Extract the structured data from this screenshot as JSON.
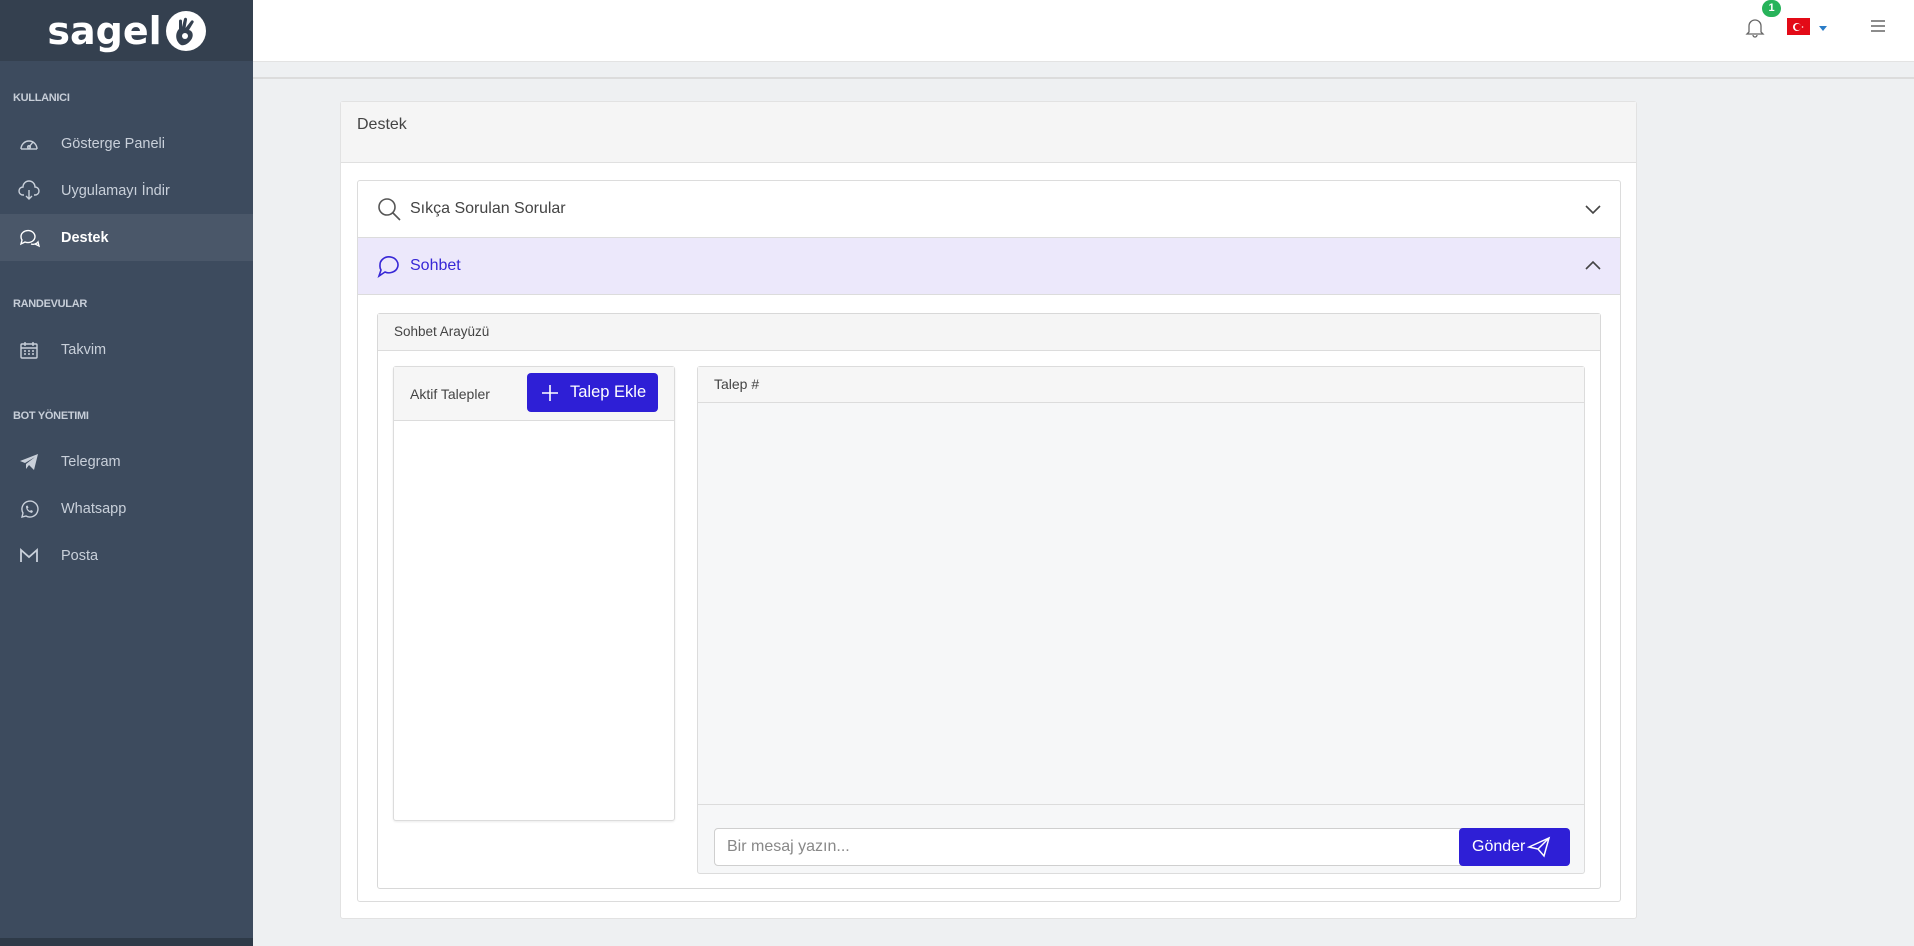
{
  "brand": {
    "name": "sagel"
  },
  "sidebar": {
    "sections": [
      {
        "title": "KULLANICI",
        "items": [
          {
            "label": "Gösterge Paneli",
            "icon": "dashboard-icon"
          },
          {
            "label": "Uygulamayı İndir",
            "icon": "cloud-download-icon"
          },
          {
            "label": "Destek",
            "icon": "chat-icon",
            "active": true
          }
        ]
      },
      {
        "title": "RANDEVULAR",
        "items": [
          {
            "label": "Takvim",
            "icon": "calendar-icon"
          }
        ]
      },
      {
        "title": "BOT YÖNETIMI",
        "items": [
          {
            "label": "Telegram",
            "icon": "telegram-icon"
          },
          {
            "label": "Whatsapp",
            "icon": "whatsapp-icon"
          },
          {
            "label": "Posta",
            "icon": "mail-icon"
          }
        ]
      }
    ]
  },
  "topbar": {
    "notification_count": "1",
    "language": "TR"
  },
  "page": {
    "title": "Destek",
    "faq_label": "Sıkça Sorulan Sorular",
    "chat_label": "Sohbet",
    "chat_interface_title": "Sohbet Arayüzü",
    "active_tickets_label": "Aktif Talepler",
    "add_ticket_label": "Talep Ekle",
    "ticket_title": "Talep #",
    "message_placeholder": "Bir mesaj yazın...",
    "send_label": "Gönder"
  },
  "colors": {
    "sidebar": "#3d4b5e",
    "accent": "#2e1fd6",
    "open_accordion": "#ece8fb",
    "badge": "#27b35a"
  }
}
